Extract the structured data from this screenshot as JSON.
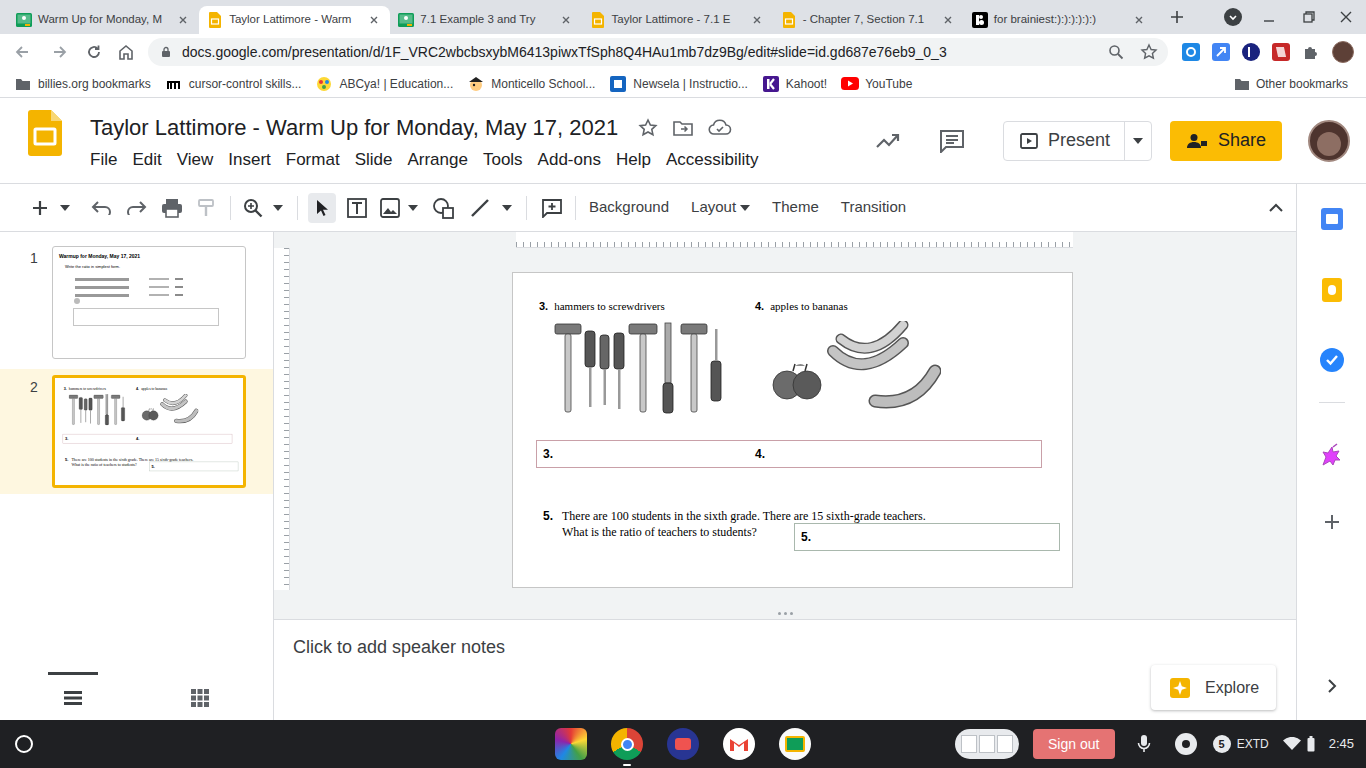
{
  "browser": {
    "tabs": [
      {
        "label": "Warm Up for Monday, M",
        "selected": false,
        "kind": "classroom"
      },
      {
        "label": "Taylor Lattimore - Warm",
        "selected": true,
        "kind": "slides"
      },
      {
        "label": "7.1 Example 3 and Try",
        "selected": false,
        "kind": "classroom"
      },
      {
        "label": "Taylor Lattimore - 7.1 E",
        "selected": false,
        "kind": "slides"
      },
      {
        "label": "- Chapter 7, Section 7.1",
        "selected": false,
        "kind": "slides"
      },
      {
        "label": "for brainiest:):):):):):)",
        "selected": false,
        "kind": "brainly"
      }
    ],
    "url": "docs.google.com/presentation/d/1F_VRC2wbcbsxybM6413piwxTfSph8Q4HAu1mb7dz9Bg/edit#slide=id.gd687e76eb9_0_3",
    "bookmarks": [
      {
        "label": "billies.org bookmarks",
        "kind": "folder"
      },
      {
        "label": "cursor-control skills...",
        "kind": "mlogo"
      },
      {
        "label": "ABCya! | Education...",
        "kind": "abcya"
      },
      {
        "label": "Monticello School...",
        "kind": "pirate"
      },
      {
        "label": "Newsela | Instructio...",
        "kind": "newsela"
      },
      {
        "label": "Kahoot!",
        "kind": "kahoot"
      },
      {
        "label": "YouTube",
        "kind": "youtube"
      }
    ],
    "other_bookmarks": "Other bookmarks"
  },
  "app": {
    "title": "Taylor Lattimore - Warm Up for Monday, May 17, 2021",
    "menu": [
      "File",
      "Edit",
      "View",
      "Insert",
      "Format",
      "Slide",
      "Arrange",
      "Tools",
      "Add-ons",
      "Help",
      "Accessibility"
    ],
    "present": "Present",
    "share": "Share",
    "toolbar": [
      {
        "label": "Background",
        "kind": "button"
      },
      {
        "label": "Layout",
        "kind": "dropdown"
      },
      {
        "label": "Theme",
        "kind": "button"
      },
      {
        "label": "Transition",
        "kind": "button"
      }
    ]
  },
  "filmstrip": {
    "slides": [
      {
        "number": "1",
        "selected": false,
        "title": "Warmup for Monday, May 17, 2021",
        "subtitle": "Write the ratio in simplest form."
      },
      {
        "number": "2",
        "selected": true
      }
    ],
    "views": [
      {
        "kind": "list",
        "selected": true
      },
      {
        "kind": "grid",
        "selected": false
      }
    ]
  },
  "slide": {
    "problems": [
      {
        "number": "3.",
        "label": "hammers to screwdrivers",
        "kind": "tools"
      },
      {
        "number": "4.",
        "label": "apples to bananas",
        "kind": "fruit"
      }
    ],
    "answers": [
      "3.",
      "4."
    ],
    "question": {
      "number": "5.",
      "lines": [
        "There are 100 students in the sixth grade. There are 15 sixth-grade teachers.",
        "What is the ratio of teachers to students?"
      ],
      "answer": "5."
    }
  },
  "notes": {
    "placeholder": "Click to add speaker notes"
  },
  "explore": {
    "label": "Explore"
  },
  "shelf": {
    "sign_out": "Sign out",
    "notifications": "5",
    "ime": "EXTD",
    "time": "2:45"
  }
}
